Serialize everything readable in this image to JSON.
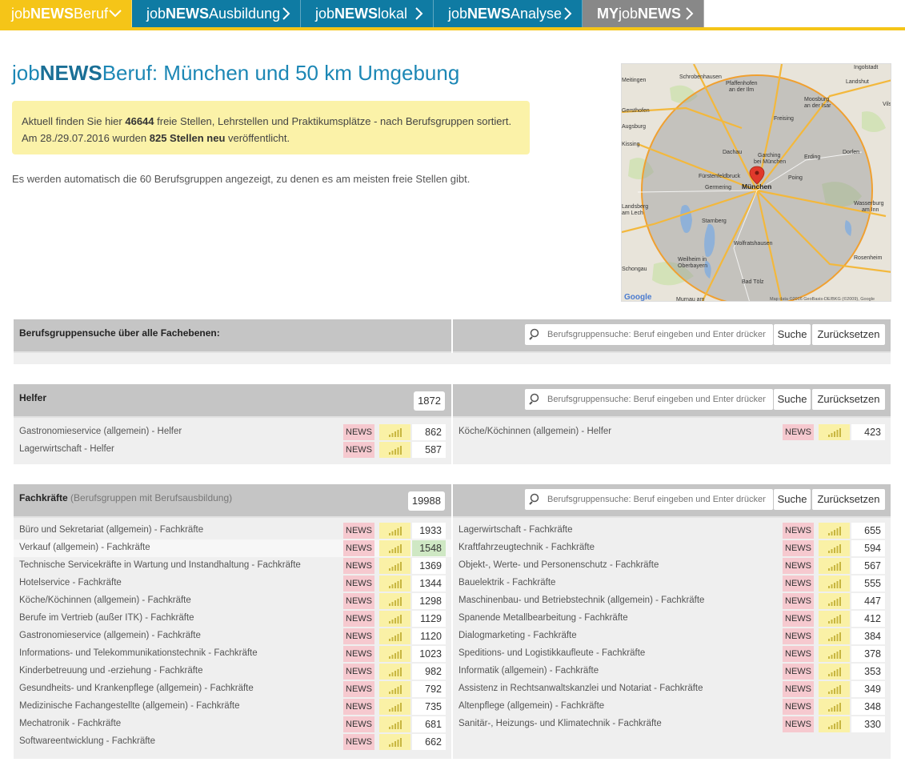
{
  "nav": {
    "items": [
      {
        "pre": "job",
        "bold": "NEWS",
        "post": "Beruf",
        "chevron": "chevron-down"
      },
      {
        "pre": "job",
        "bold": "NEWS",
        "post": "Ausbildung",
        "chevron": "chevron-right"
      },
      {
        "pre": "job",
        "bold": "NEWS",
        "post": "lokal",
        "chevron": "chevron-right"
      },
      {
        "pre": "job",
        "bold": "NEWS",
        "post": "Analyse",
        "chevron": "chevron-right"
      },
      {
        "pre": "MY",
        "bold": "job",
        "post": "NEWS",
        "chevron": "chevron-right"
      }
    ],
    "colors": {
      "accent": "#f5c518",
      "primary": "#0f7ba3",
      "my": "#888888"
    }
  },
  "header": {
    "title_pre": "job",
    "title_bold": "NEWS",
    "title_post": "Beruf: München und 50 km Umgebung",
    "notice_line1_a": "Aktuell finden Sie hier ",
    "notice_count": "46644",
    "notice_line1_b": " freie Stellen, Lehrstellen und Praktikumsplätze - nach Berufsgruppen sortiert.",
    "notice_line2_a": "Am 28./29.07.2016 wurden ",
    "notice_new": "825 Stellen neu",
    "notice_line2_b": " veröffentlicht.",
    "hint": "Es werden automatisch die 60 Berufsgruppen angezeigt, zu denen es am meisten freie Stellen gibt."
  },
  "map": {
    "places": [
      "Neuburg",
      "Schrobenhausen",
      "Pfaffenhofen an der Ilm",
      "Ingolstadt",
      "Landshut",
      "Freising",
      "Moosburg an der Isar",
      "Augsburg",
      "Gersthofen",
      "Dachau",
      "Garching bei München",
      "Fürstenfeldbruck",
      "Germering",
      "München",
      "Poing",
      "Erding",
      "Dorfen",
      "Starnberg",
      "Wolfratshausen",
      "Landsberg am Lech",
      "Weilheim in Oberbayern",
      "Bad Tölz",
      "Rosenheim",
      "Wasserburg am Inn",
      "Schongau",
      "Murnau am",
      "Meitingen",
      "Kissing",
      "Vilsbiburg"
    ],
    "attribution": "Map data ©2016 GeoBasis-DE/BKG (©2009), Google",
    "logo": "Google"
  },
  "search": {
    "section_label": "Berufsgruppensuche über alle Fachebenen:",
    "placeholder": "Berufsgruppensuche: Beruf eingeben und Enter drücken",
    "search_label": "Suche",
    "reset_label": "Zurücksetzen"
  },
  "news_label": "NEWS",
  "sections": [
    {
      "title": "Helfer",
      "subtitle": "",
      "total": "1872",
      "left": [
        {
          "label": "Gastronomieservice (allgemein) - Helfer",
          "count": "862"
        },
        {
          "label": "Lagerwirtschaft - Helfer",
          "count": "587"
        }
      ],
      "right": [
        {
          "label": "Köche/Köchinnen (allgemein) - Helfer",
          "count": "423"
        }
      ]
    },
    {
      "title": "Fachkräfte",
      "subtitle": " (Berufsgruppen mit Berufsausbildung)",
      "total": "19988",
      "left": [
        {
          "label": "Büro und Sekretariat (allgemein) - Fachkräfte",
          "count": "1933"
        },
        {
          "label": "Verkauf (allgemein) - Fachkräfte",
          "count": "1548",
          "highlight": true
        },
        {
          "label": "Technische Servicekräfte in Wartung und Instandhaltung - Fachkräfte",
          "count": "1369"
        },
        {
          "label": "Hotelservice - Fachkräfte",
          "count": "1344"
        },
        {
          "label": "Köche/Köchinnen (allgemein) - Fachkräfte",
          "count": "1298"
        },
        {
          "label": "Berufe im Vertrieb (außer ITK) - Fachkräfte",
          "count": "1129"
        },
        {
          "label": "Gastronomieservice (allgemein) - Fachkräfte",
          "count": "1120"
        },
        {
          "label": "Informations- und Telekommunikationstechnik - Fachkräfte",
          "count": "1023"
        },
        {
          "label": "Kinderbetreuung und -erziehung - Fachkräfte",
          "count": "982"
        },
        {
          "label": "Gesundheits- und Krankenpflege (allgemein) - Fachkräfte",
          "count": "792"
        },
        {
          "label": "Medizinische Fachangestellte (allgemein) - Fachkräfte",
          "count": "735"
        },
        {
          "label": "Mechatronik - Fachkräfte",
          "count": "681"
        },
        {
          "label": "Softwareentwicklung - Fachkräfte",
          "count": "662"
        }
      ],
      "right": [
        {
          "label": "Lagerwirtschaft - Fachkräfte",
          "count": "655"
        },
        {
          "label": "Kraftfahrzeugtechnik - Fachkräfte",
          "count": "594"
        },
        {
          "label": "Objekt-, Werte- und Personenschutz - Fachkräfte",
          "count": "567"
        },
        {
          "label": "Bauelektrik - Fachkräfte",
          "count": "555"
        },
        {
          "label": "Maschinenbau- und Betriebstechnik (allgemein) - Fachkräfte",
          "count": "447"
        },
        {
          "label": "Spanende Metallbearbeitung - Fachkräfte",
          "count": "412"
        },
        {
          "label": "Dialogmarketing - Fachkräfte",
          "count": "384"
        },
        {
          "label": "Speditions- und Logistikkaufleute - Fachkräfte",
          "count": "378"
        },
        {
          "label": "Informatik (allgemein) - Fachkräfte",
          "count": "353"
        },
        {
          "label": "Assistenz in Rechtsanwaltskanzlei und Notariat - Fachkräfte",
          "count": "349"
        },
        {
          "label": "Altenpflege (allgemein) - Fachkräfte",
          "count": "348"
        },
        {
          "label": "Sanitär-, Heizungs- und Klimatechnik - Fachkräfte",
          "count": "330"
        }
      ]
    }
  ]
}
